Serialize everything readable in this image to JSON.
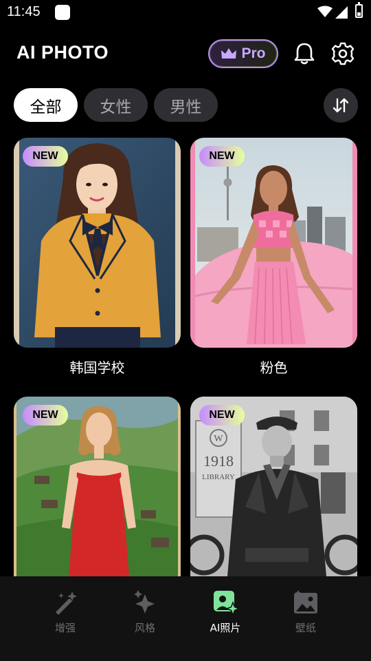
{
  "status_bar": {
    "time": "11:45"
  },
  "header": {
    "title": "AI PHOTO",
    "pro_label": "Pro"
  },
  "filters": {
    "items": [
      "全部",
      "女性",
      "男性"
    ],
    "selected": "全部"
  },
  "cards": [
    {
      "badge": "NEW",
      "label": "韩国学校"
    },
    {
      "badge": "NEW",
      "label": "粉色"
    },
    {
      "badge": "NEW",
      "label": ""
    },
    {
      "badge": "NEW",
      "label": ""
    }
  ],
  "photo_text": {
    "sign_year": "1918",
    "sign_word": "LIBRARY",
    "sign_letter": "W"
  },
  "bottom_nav": {
    "items": [
      {
        "label": "增强",
        "icon": "magic-wand-icon"
      },
      {
        "label": "风格",
        "icon": "sparkle-icon"
      },
      {
        "label": "AI照片",
        "icon": "ai-portrait-icon"
      },
      {
        "label": "壁纸",
        "icon": "wallpaper-icon"
      }
    ],
    "active": "AI照片"
  },
  "colors": {
    "accent_purple": "#b88cf4",
    "accent_green": "#7fe39a",
    "chip_bg": "#2f2f33"
  }
}
